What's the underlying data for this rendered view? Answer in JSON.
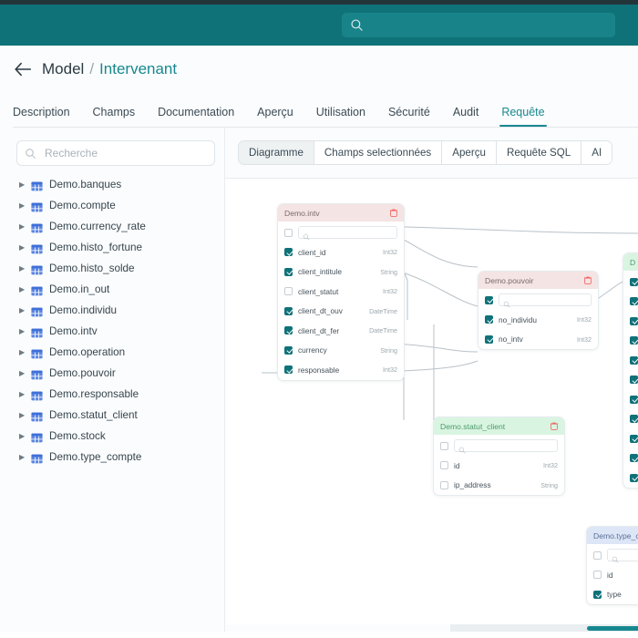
{
  "topbar": {
    "search_placeholder": "",
    "search_value": "",
    "search_icon": "search-icon"
  },
  "header": {
    "back_icon": "back-arrow-icon",
    "breadcrumb_root": "Model",
    "breadcrumb_separator": "/",
    "breadcrumb_current": "Intervenant",
    "tabs": [
      {
        "label": "Description",
        "active": false
      },
      {
        "label": "Champs",
        "active": false
      },
      {
        "label": "Documentation",
        "active": false
      },
      {
        "label": "Aperçu",
        "active": false
      },
      {
        "label": "Utilisation",
        "active": false
      },
      {
        "label": "Sécurité",
        "active": false
      },
      {
        "label": "Audit",
        "active": false
      },
      {
        "label": "Requête",
        "active": true
      }
    ]
  },
  "sidebar": {
    "search_placeholder": "Recherche",
    "search_value": "",
    "search_icon": "search-icon",
    "items": [
      {
        "label": "Demo.banques"
      },
      {
        "label": "Demo.compte"
      },
      {
        "label": "Demo.currency_rate"
      },
      {
        "label": "Demo.histo_fortune"
      },
      {
        "label": "Demo.histo_solde"
      },
      {
        "label": "Demo.in_out"
      },
      {
        "label": "Demo.individu"
      },
      {
        "label": "Demo.intv"
      },
      {
        "label": "Demo.operation"
      },
      {
        "label": "Demo.pouvoir"
      },
      {
        "label": "Demo.responsable"
      },
      {
        "label": "Demo.statut_client"
      },
      {
        "label": "Demo.stock"
      },
      {
        "label": "Demo.type_compte"
      }
    ]
  },
  "main": {
    "segments": [
      {
        "label": "Diagramme",
        "active": true
      },
      {
        "label": "Champs selectionnées",
        "active": false
      },
      {
        "label": "Aperçu",
        "active": false
      },
      {
        "label": "Requête SQL",
        "active": false
      },
      {
        "label": "AI",
        "active": false
      }
    ]
  },
  "diagram": {
    "nodes": [
      {
        "id": "intv",
        "title": "Demo.intv",
        "header_style": "pink",
        "header_all_checked": false,
        "search_value": "",
        "fields": [
          {
            "name": "client_id",
            "type": "Int32",
            "checked": true
          },
          {
            "name": "client_intitule",
            "type": "String",
            "checked": true
          },
          {
            "name": "client_statut",
            "type": "Int32",
            "checked": false
          },
          {
            "name": "client_dt_ouv",
            "type": "DateTime",
            "checked": true
          },
          {
            "name": "client_dt_fer",
            "type": "DateTime",
            "checked": true
          },
          {
            "name": "currency",
            "type": "String",
            "checked": true
          },
          {
            "name": "responsable",
            "type": "Int32",
            "checked": true
          }
        ]
      },
      {
        "id": "pouvoir",
        "title": "Demo.pouvoir",
        "header_style": "pink",
        "header_all_checked": true,
        "search_value": "",
        "fields": [
          {
            "name": "no_individu",
            "type": "Int32",
            "checked": true
          },
          {
            "name": "no_intv",
            "type": "Int32",
            "checked": true
          }
        ]
      },
      {
        "id": "statut_client",
        "title": "Demo.statut_client",
        "header_style": "green",
        "header_all_checked": false,
        "search_value": "",
        "fields": [
          {
            "name": "id",
            "type": "Int32",
            "checked": false
          },
          {
            "name": "ip_address",
            "type": "String",
            "checked": false
          }
        ]
      },
      {
        "id": "type_compte",
        "title": "Demo.type_co",
        "header_style": "blue",
        "header_all_checked": false,
        "search_value": "",
        "fields": [
          {
            "name": "id",
            "type": "",
            "checked": false
          },
          {
            "name": "type",
            "type": "",
            "checked": true
          }
        ]
      },
      {
        "id": "edge_node",
        "title": "D",
        "header_style": "green",
        "header_all_checked": true,
        "search_value": "",
        "fields": [
          {
            "name": "",
            "type": "",
            "checked": true
          },
          {
            "name": "",
            "type": "",
            "checked": true
          },
          {
            "name": "",
            "type": "",
            "checked": true
          },
          {
            "name": "",
            "type": "",
            "checked": true
          },
          {
            "name": "",
            "type": "",
            "checked": true
          },
          {
            "name": "",
            "type": "",
            "checked": true
          },
          {
            "name": "",
            "type": "",
            "checked": true
          },
          {
            "name": "",
            "type": "",
            "checked": true
          },
          {
            "name": "",
            "type": "",
            "checked": true
          },
          {
            "name": "",
            "type": "",
            "checked": true
          }
        ]
      }
    ]
  },
  "colors": {
    "brand_teal": "#0f7279",
    "accent_teal": "#17888f",
    "header_pink": "#f4e4e4",
    "header_green": "#d9f5e2",
    "header_blue": "#dde6f7",
    "delete_red": "#ef5350",
    "table_icon_blue": "#3f6fd8"
  },
  "scrollbar": {
    "orientation": "horizontal"
  }
}
